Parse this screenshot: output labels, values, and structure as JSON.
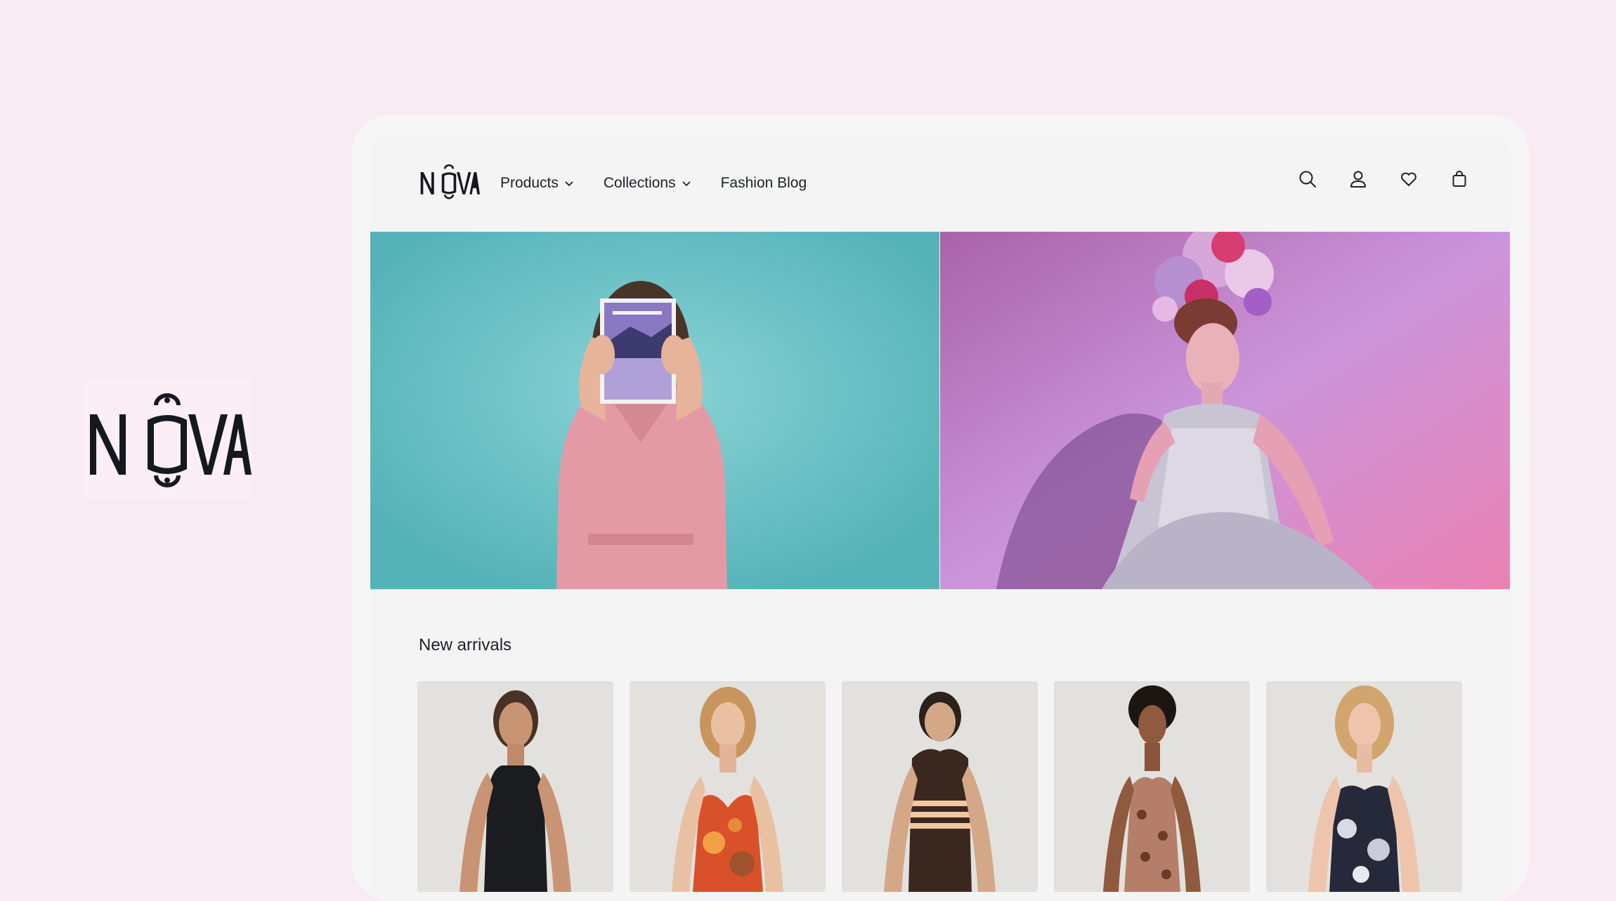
{
  "brand": {
    "name": "NOVA"
  },
  "header": {
    "nav": [
      {
        "label": "Products",
        "has_dropdown": true
      },
      {
        "label": "Collections",
        "has_dropdown": true
      },
      {
        "label": "Fashion Blog",
        "has_dropdown": false
      }
    ],
    "icons": [
      "search-icon",
      "account-icon",
      "wishlist-heart-icon",
      "shopping-bag-icon"
    ]
  },
  "hero": {
    "left_image": "woman-holding-magazine-teal-background",
    "right_image": "model-floral-headpiece-purple-background"
  },
  "new_arrivals": {
    "title": "New arrivals",
    "products": [
      {
        "image": "black-tank-dress"
      },
      {
        "image": "orange-floral-slip-dress"
      },
      {
        "image": "brown-striped-knit-dress"
      },
      {
        "image": "paisley-midi-slip-dress"
      },
      {
        "image": "black-white-floral-slip-dress"
      }
    ]
  },
  "colors": {
    "page_bg": "#f9ebf3",
    "card_bg": "#f6f6f6",
    "text": "#1d2228",
    "hero_left": "#5fb9bd",
    "hero_right": "#c98fd6"
  }
}
